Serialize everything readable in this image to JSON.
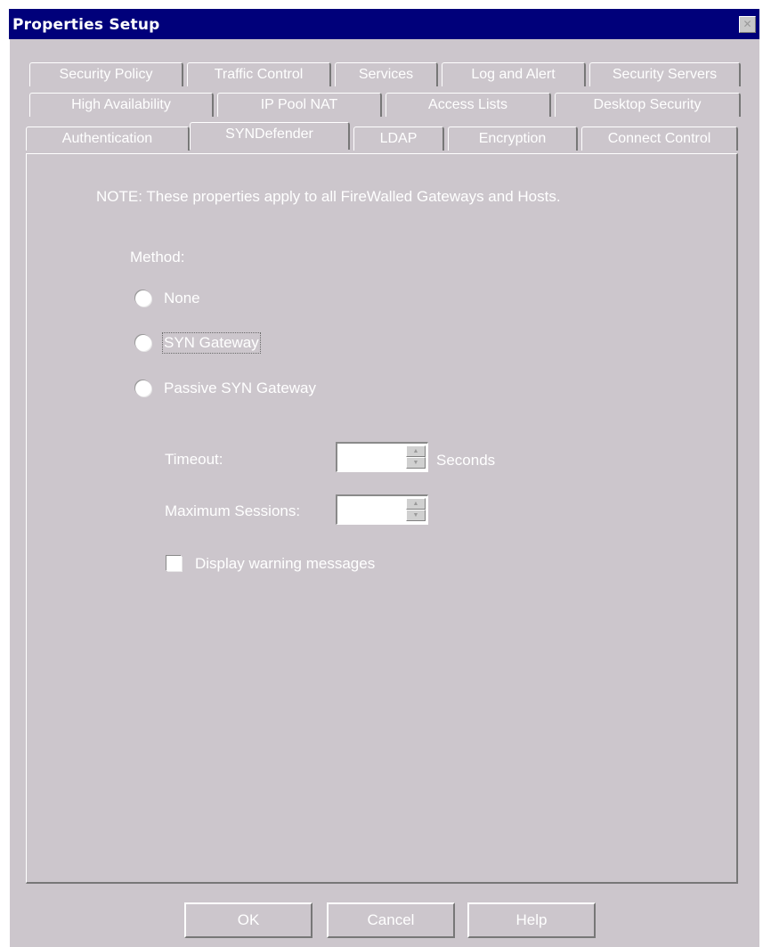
{
  "window": {
    "title": "Properties Setup",
    "close_glyph": "✕"
  },
  "tabs": {
    "row1": [
      "Security Policy",
      "Traffic Control",
      "Services",
      "Log and Alert",
      "Security Servers"
    ],
    "row2": [
      "High Availability",
      "IP Pool NAT",
      "Access Lists",
      "Desktop Security"
    ],
    "row3": [
      "Authentication",
      "SYNDefender",
      "LDAP",
      "Encryption",
      "Connect Control"
    ],
    "active": "SYNDefender"
  },
  "panel": {
    "note": "NOTE: These properties apply to all FireWalled Gateways and Hosts.",
    "method_label": "Method:",
    "radio_options": [
      {
        "label": "None",
        "selected": false
      },
      {
        "label": "SYN Gateway",
        "selected": false
      },
      {
        "label": "Passive SYN Gateway",
        "selected": false
      }
    ],
    "timeout_label": "Timeout:",
    "timeout_value": "",
    "timeout_unit": "Seconds",
    "max_sessions_label": "Maximum Sessions:",
    "max_sessions_value": "",
    "display_warning_label": "Display warning messages",
    "display_warning_checked": false
  },
  "buttons": {
    "ok": "OK",
    "cancel": "Cancel",
    "help": "Help"
  }
}
